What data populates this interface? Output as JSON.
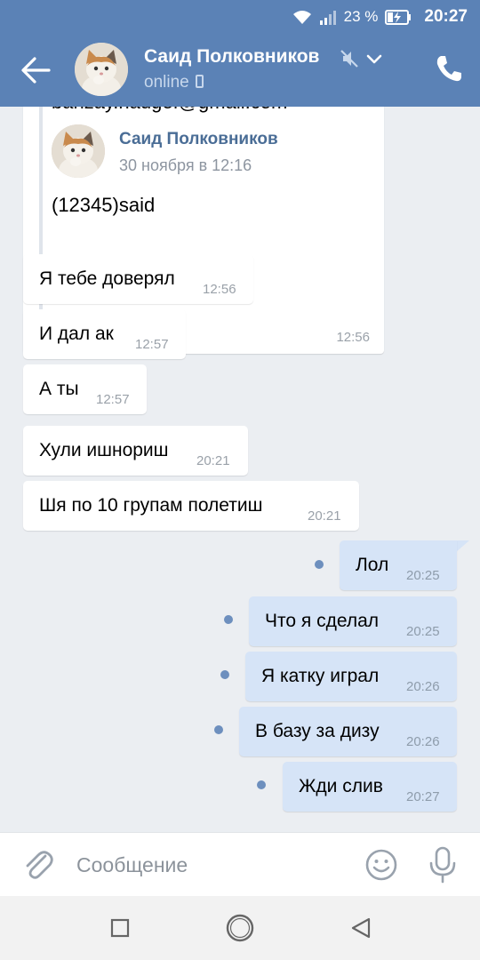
{
  "status_bar": {
    "battery": "23 %",
    "time": "20:27",
    "icons": [
      "wifi-icon",
      "signal-icon",
      "battery-charging-icon"
    ]
  },
  "header": {
    "contact_name": "Саид Полковников",
    "status": "online",
    "icons": [
      "back-arrow-icon",
      "avatar",
      "mute-icon",
      "chevron-down-icon",
      "mobile-icon",
      "phone-icon"
    ]
  },
  "forwarded": {
    "cut_text": "banzay.nadgef@gmail.com",
    "author": "Саид Полковников",
    "date": "30 ноября в 12:16",
    "text": "(12345)said",
    "time": "12:56"
  },
  "messages": [
    {
      "direction": "in",
      "text": "Я тебе доверял",
      "time": "12:56"
    },
    {
      "direction": "in",
      "text": "И дал ак",
      "time": "12:57"
    },
    {
      "direction": "in",
      "text": "А ты",
      "time": "12:57"
    },
    {
      "direction": "in",
      "text": "Хули ишнориш",
      "time": "20:21"
    },
    {
      "direction": "in",
      "text": "Шя по 10 групам полетиш",
      "time": "20:21"
    },
    {
      "direction": "out",
      "text": "Лол",
      "time": "20:25",
      "unread": true
    },
    {
      "direction": "out",
      "text": "Что я сделал",
      "time": "20:25",
      "unread": true
    },
    {
      "direction": "out",
      "text": "Я катку играл",
      "time": "20:26",
      "unread": true
    },
    {
      "direction": "out",
      "text": "В базу за дизу",
      "time": "20:26",
      "unread": true
    },
    {
      "direction": "out",
      "text": "Жди слив",
      "time": "20:27",
      "unread": true
    }
  ],
  "input": {
    "placeholder": "Сообщение",
    "icons": [
      "attachment-icon",
      "emoji-icon",
      "microphone-icon"
    ]
  },
  "nav": {
    "icons": [
      "recent-apps-icon",
      "home-icon",
      "back-triangle-icon"
    ]
  },
  "colors": {
    "header": "#5b82b6",
    "background": "#ebeef2",
    "incoming_bubble": "#ffffff",
    "outgoing_bubble": "#d6e4f7",
    "unread_dot": "#6d8fbe",
    "link_name": "#4a6d96"
  }
}
